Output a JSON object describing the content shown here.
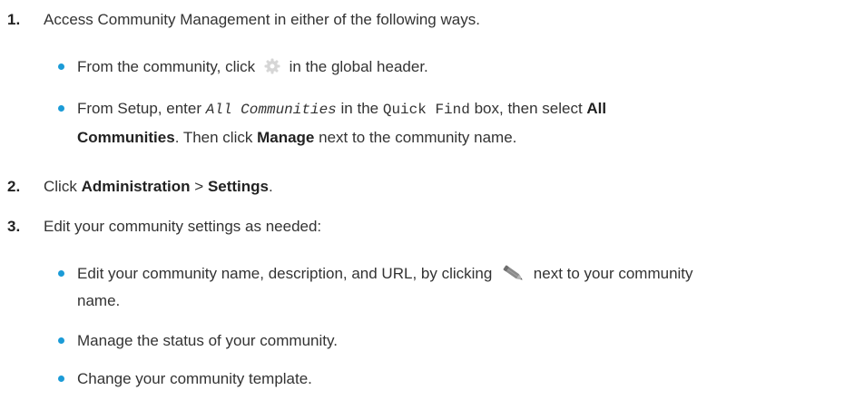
{
  "steps": [
    {
      "number": "1.",
      "text": "Access Community Management in either of the following ways.",
      "bullets": [
        {
          "before": "From the community, click",
          "icon": "gear-icon",
          "after": "in the global header."
        },
        {
          "part1": "From Setup, enter",
          "code_italic": "All Communities",
          "part2": "in the",
          "code": "Quick Find",
          "part3": "box, then select",
          "bold1": "All",
          "bold1b": "Communities",
          "part4": ". Then click",
          "bold2": "Manage",
          "part5": "next to the community name."
        }
      ]
    },
    {
      "number": "2.",
      "part1": "Click",
      "bold1": "Administration",
      "sep": ">",
      "bold2": "Settings",
      "end": "."
    },
    {
      "number": "3.",
      "text": "Edit your community settings as needed:",
      "bullets": [
        {
          "before": "Edit your community name, description, and URL, by clicking",
          "icon": "pencil-icon",
          "after": "next to your community",
          "after2": "name."
        },
        {
          "text": "Manage the status of your community."
        },
        {
          "text": "Change your community template."
        }
      ]
    }
  ],
  "colors": {
    "bullet": "#1b9bd7",
    "text": "#333333"
  }
}
